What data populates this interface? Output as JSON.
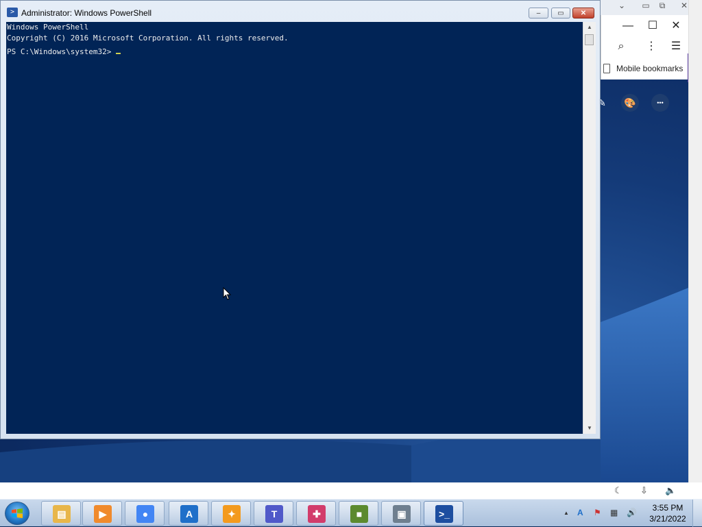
{
  "powershell": {
    "title": "Administrator: Windows PowerShell",
    "console_lines": [
      "Windows PowerShell",
      "Copyright (C) 2016 Microsoft Corporation. All rights reserved.",
      "",
      "PS C:\\Windows\\system32> "
    ],
    "minimize_label": "–",
    "maximize_label": "▭",
    "close_label": "✕",
    "scroll_up": "▲",
    "scroll_down": "▼"
  },
  "browser": {
    "minimize_label": "—",
    "maximize_label": "☐",
    "close_label": "✕",
    "search_icon": "⌕",
    "more_icon": "⋮",
    "menu_icon": "☰",
    "bookmarks_label": "Mobile bookmarks",
    "palette_icon": "🎨",
    "more_dots": "•••"
  },
  "notification_bar": {
    "moon_icon": "☾",
    "download_icon": "⇩",
    "volume_icon": "🔈"
  },
  "taskbar": {
    "apps": [
      {
        "name": "file-explorer",
        "glyph": "▤",
        "color": "#e8b64a"
      },
      {
        "name": "media-player",
        "glyph": "▶",
        "color": "#f08a2c"
      },
      {
        "name": "chrome",
        "glyph": "●",
        "color": "#4285f4"
      },
      {
        "name": "app-a",
        "glyph": "A",
        "color": "#1f6fc9"
      },
      {
        "name": "uc-browser",
        "glyph": "✦",
        "color": "#f39a1e"
      },
      {
        "name": "teams",
        "glyph": "T",
        "color": "#5059c9"
      },
      {
        "name": "colorful-app",
        "glyph": "✚",
        "color": "#d23c6b"
      },
      {
        "name": "minecraft",
        "glyph": "■",
        "color": "#5c8a2e"
      },
      {
        "name": "system-monitor",
        "glyph": "▣",
        "color": "#6f7f8f"
      },
      {
        "name": "powershell",
        "glyph": ">_",
        "color": "#1d4ea0"
      }
    ],
    "tray": {
      "expand_icon": "▲",
      "lang_icon": "A",
      "flag_icon": "⚑",
      "network_icon": "▦",
      "volume_icon": "🔊"
    },
    "time": "3:55 PM",
    "date": "3/21/2022"
  }
}
